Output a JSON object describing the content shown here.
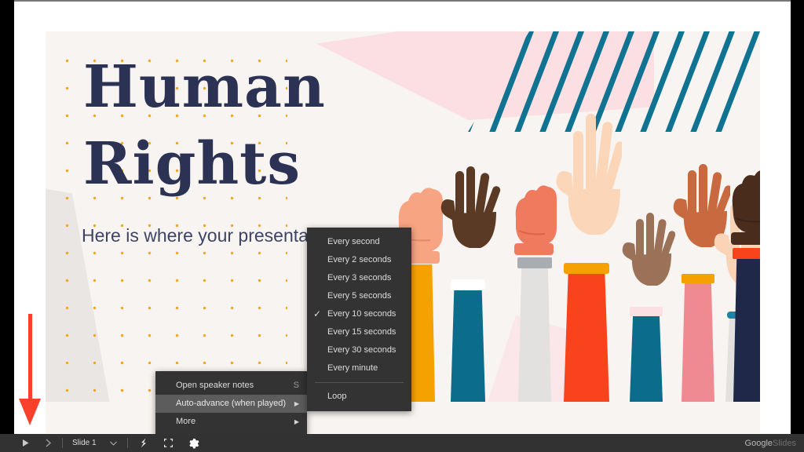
{
  "app": {
    "brand_primary": "Google",
    "brand_secondary": "Slides"
  },
  "slide": {
    "title_line1": "Human",
    "title_line2": "Rights",
    "subtitle": "Here is where your presentation begins",
    "colors": {
      "background": "#f8f4f1",
      "title_navy": "#2b3254",
      "dot_orange": "#f5a623",
      "stripe_teal": "#0f7391",
      "pink": "#fbdfe3",
      "grey_wedge": "#e9e6e4"
    }
  },
  "annotation": {
    "arrow_color": "#f9402c",
    "arrow_direction": "down"
  },
  "context_menu": {
    "items": [
      {
        "label": "Open speaker notes",
        "accel": "S",
        "submenu": false,
        "highlighted": false
      },
      {
        "label": "Auto-advance (when played)",
        "accel": "",
        "submenu": true,
        "highlighted": true
      },
      {
        "label": "More",
        "accel": "",
        "submenu": true,
        "highlighted": false
      }
    ]
  },
  "submenu": {
    "items": [
      {
        "label": "Every second",
        "checked": false
      },
      {
        "label": "Every 2 seconds",
        "checked": false
      },
      {
        "label": "Every 3 seconds",
        "checked": false
      },
      {
        "label": "Every 5 seconds",
        "checked": false
      },
      {
        "label": "Every 10 seconds",
        "checked": true
      },
      {
        "label": "Every 15 seconds",
        "checked": false
      },
      {
        "label": "Every 30 seconds",
        "checked": false
      },
      {
        "label": "Every minute",
        "checked": false
      }
    ],
    "loop_label": "Loop"
  },
  "toolbar": {
    "play_icon": "play-icon",
    "next_icon": "next-slide-icon",
    "slide_label": "Slide 1",
    "dropdown_icon": "chevron-down-icon",
    "laser_icon": "laser-pointer-icon",
    "fullscreen_icon": "fullscreen-icon",
    "settings_icon": "gear-icon"
  },
  "hands": [
    {
      "name": "fist-light-orange-sleeve",
      "skin": "#f6a482",
      "sleeve": "#f5a200",
      "cuff": "#f6a482",
      "type": "fist"
    },
    {
      "name": "open-hand-dark-teal-sleeve",
      "skin": "#5b3a25",
      "sleeve": "#0c6c8c",
      "cuff": "#ffffff",
      "type": "open"
    },
    {
      "name": "fist-coral-grey-sleeve",
      "skin": "#ef7a5e",
      "sleeve": "#e3e1df",
      "cuff": "#a8adb2",
      "type": "fist"
    },
    {
      "name": "open-hand-pale-red-sleeve",
      "skin": "#fcd6b8",
      "sleeve": "#f8431d",
      "cuff": "#f5a200",
      "type": "open"
    },
    {
      "name": "open-hand-brown-teal-sleeve",
      "skin": "#9b7257",
      "sleeve": "#0c6c8c",
      "cuff": "#fbdfe3",
      "type": "open"
    },
    {
      "name": "open-hand-tan-pink-sleeve",
      "skin": "#c8693f",
      "sleeve": "#f08a92",
      "cuff": "#f5a200",
      "type": "open"
    },
    {
      "name": "open-hand-pale-grey-sleeve",
      "skin": "#fbd3b6",
      "sleeve": "#e3e1df",
      "cuff": "#1787a3",
      "type": "open"
    },
    {
      "name": "fist-dark-navy-sleeve",
      "skin": "#4a2c1d",
      "sleeve": "#1f2848",
      "cuff": "#f8431d",
      "type": "fist"
    }
  ]
}
